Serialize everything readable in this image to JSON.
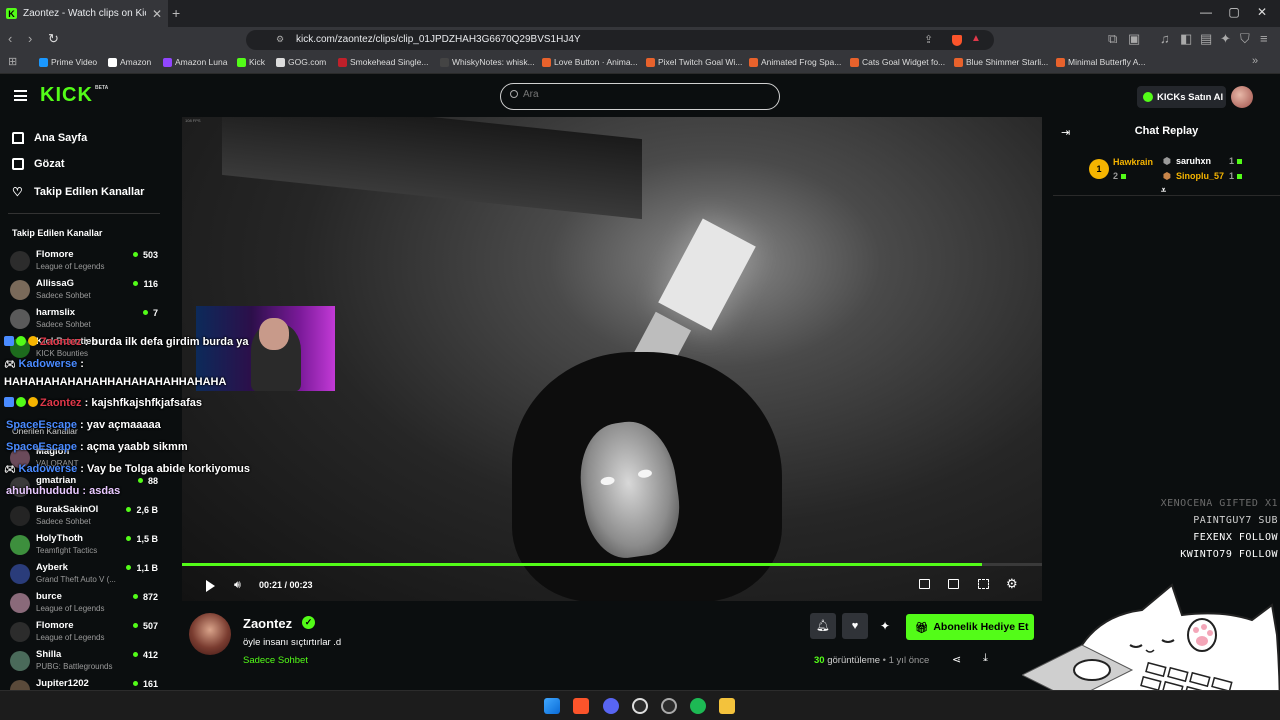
{
  "browser": {
    "tab_title": "Zaontez - Watch clips on Kick",
    "url": "kick.com/zaontez/clips/clip_01JPDZHAH3G6670Q29BVS1HJ4Y",
    "bookmarks": [
      "Prime Video",
      "Amazon",
      "Amazon Luna",
      "Kick",
      "GOG.com",
      "Smokehead Single...",
      "WhiskyNotes: whisk...",
      "Love Button · Anima...",
      "Pixel Twitch Goal Wi...",
      "Animated Frog Spa...",
      "Cats Goal Widget fo...",
      "Blue Shimmer Starli...",
      "Minimal Butterfly A..."
    ]
  },
  "header": {
    "logo": "KICK",
    "beta": "BETA",
    "search_placeholder": "Ara",
    "buy_kicks": "KICKs Satın Al"
  },
  "sidebar": {
    "nav": [
      "Ana Sayfa",
      "Gözat",
      "Takip Edilen Kanallar"
    ],
    "followed_heading": "Takip Edilen Kanallar",
    "channels": [
      {
        "name": "Flomore",
        "category": "League of Legends",
        "viewers": "503"
      },
      {
        "name": "AllissaG",
        "category": "Sadece Sohbet",
        "viewers": "116"
      },
      {
        "name": "harmslix",
        "category": "Sadece Sohbet",
        "viewers": "7"
      },
      {
        "name": "KickBounties",
        "category": "KICK Bounties",
        "viewers": ""
      }
    ],
    "recommended_heading": "Önerilen Kanallar",
    "recommended": [
      {
        "name": "Magion",
        "category": "VALORANT",
        "viewers": ""
      },
      {
        "name": "gmatrian",
        "category": "",
        "viewers": "88"
      },
      {
        "name": "BurakSakinOl",
        "category": "Sadece Sohbet",
        "viewers": "2,6 B"
      },
      {
        "name": "HolyThoth",
        "category": "Teamfight Tactics",
        "viewers": "1,5 B"
      },
      {
        "name": "Ayberk",
        "category": "Grand Theft Auto V (...",
        "viewers": "1,1 B"
      },
      {
        "name": "burce",
        "category": "League of Legends",
        "viewers": "872"
      },
      {
        "name": "Flomore",
        "category": "League of Legends",
        "viewers": "507"
      },
      {
        "name": "Shilla",
        "category": "PUBG: Battlegrounds",
        "viewers": "412"
      },
      {
        "name": "Jupiter1202",
        "category": "",
        "viewers": "161"
      }
    ]
  },
  "video": {
    "time": "00:21 / 00:23",
    "progress": 0.93,
    "watermark": "108 FPS"
  },
  "chat_overlay": [
    {
      "user": "Zaontez",
      "msg": ": burda ilk defa girdim burda ya"
    },
    {
      "user": "Kadowerse",
      "msg": " :"
    },
    {
      "user": "",
      "msg": "HAHAHAHAHAHAHHAHAHAHAHHAHAHA"
    },
    {
      "user": "Zaontez",
      "msg": ": kajshfkajshfkjafsafas"
    },
    {
      "user": "SpaceEscape",
      "msg": ": yav açmaaaaa"
    },
    {
      "user": "SpaceEscape",
      "msg": ": açma yaabb sikmm"
    },
    {
      "user": "Kadowerse",
      "msg": ": Vay be Tolga abide korkiyomus"
    },
    {
      "user": "",
      "msg": "ahuhuhududu : asdas"
    }
  ],
  "streamer": {
    "name": "Zaontez",
    "clip_title": "öyle insanı sıçtırtırlar .d",
    "category": "Sadece Sohbet",
    "gift_button": "Abonelik Hediye Et",
    "views_count": "30",
    "views_label": "görüntüleme",
    "time_ago": "• 1 yıl önce"
  },
  "chat_replay": {
    "title": "Chat Replay",
    "leaderboard": [
      {
        "rank": "1",
        "name": "Hawkrain",
        "count": "2"
      },
      {
        "name": "saruhxn",
        "count": "1"
      },
      {
        "name": "Sinoplu_57",
        "count": "1"
      }
    ]
  },
  "overlay_alerts": [
    "XENOCENA GIFTED X1",
    "PAINTGUY7 SUB",
    "FEXENX FOLLOW",
    "KWINTO79 FOLLOW"
  ],
  "colors": {
    "accent": "#53fc18",
    "bg": "#0b0e0f"
  }
}
